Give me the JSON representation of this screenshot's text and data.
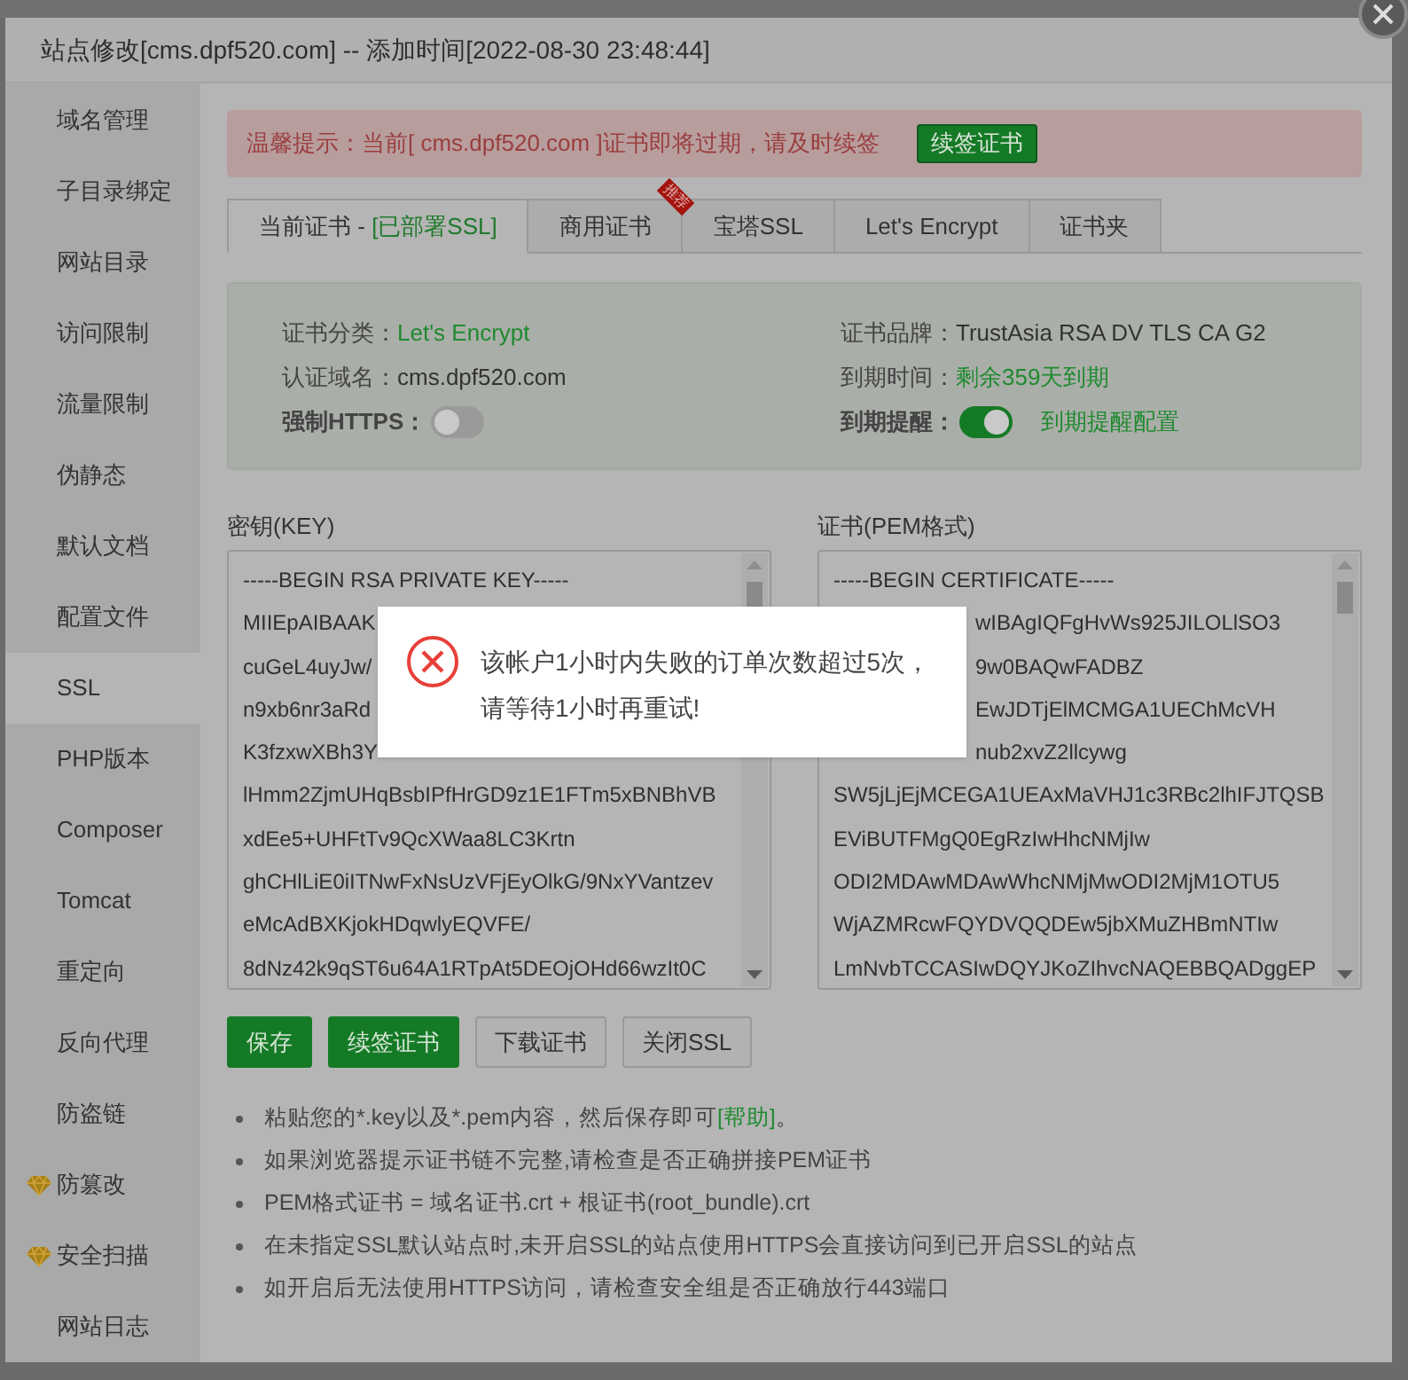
{
  "dialog": {
    "title": "站点修改[cms.dpf520.com] -- 添加时间[2022-08-30 23:48:44]"
  },
  "sidebar": {
    "items": [
      {
        "label": "域名管理",
        "selected": false,
        "premium": false
      },
      {
        "label": "子目录绑定",
        "selected": false,
        "premium": false
      },
      {
        "label": "网站目录",
        "selected": false,
        "premium": false
      },
      {
        "label": "访问限制",
        "selected": false,
        "premium": false
      },
      {
        "label": "流量限制",
        "selected": false,
        "premium": false
      },
      {
        "label": "伪静态",
        "selected": false,
        "premium": false
      },
      {
        "label": "默认文档",
        "selected": false,
        "premium": false
      },
      {
        "label": "配置文件",
        "selected": false,
        "premium": false
      },
      {
        "label": "SSL",
        "selected": true,
        "premium": false
      },
      {
        "label": "PHP版本",
        "selected": false,
        "premium": false
      },
      {
        "label": "Composer",
        "selected": false,
        "premium": false
      },
      {
        "label": "Tomcat",
        "selected": false,
        "premium": false
      },
      {
        "label": "重定向",
        "selected": false,
        "premium": false
      },
      {
        "label": "反向代理",
        "selected": false,
        "premium": false
      },
      {
        "label": "防盗链",
        "selected": false,
        "premium": false
      },
      {
        "label": "防篡改",
        "selected": false,
        "premium": true
      },
      {
        "label": "安全扫描",
        "selected": false,
        "premium": true
      },
      {
        "label": "网站日志",
        "selected": false,
        "premium": false
      }
    ]
  },
  "alert": {
    "text": "温馨提示：当前[ cms.dpf520.com ]证书即将过期，请及时续签",
    "button": "续签证书"
  },
  "tabs": [
    {
      "label": "当前证书 - ",
      "status": "[已部署SSL]",
      "selected": true
    },
    {
      "label": "商用证书",
      "ribbon": "推荐",
      "selected": false
    },
    {
      "label": "宝塔SSL",
      "selected": false
    },
    {
      "label": "Let's Encrypt",
      "selected": false
    },
    {
      "label": "证书夹",
      "selected": false
    }
  ],
  "cert_info": [
    {
      "label": "证书分类：",
      "value": "Let's Encrypt",
      "kind": "green"
    },
    {
      "label": "证书品牌：",
      "value": "TrustAsia RSA DV TLS CA G2",
      "kind": "plain"
    },
    {
      "label": "认证域名：",
      "value": "cms.dpf520.com",
      "kind": "plain"
    },
    {
      "label": "到期时间：",
      "value": "剩余359天到期",
      "kind": "green"
    },
    {
      "label": "强制HTTPS：",
      "on": false,
      "kind": "toggle"
    },
    {
      "label": "到期提醒：",
      "on": true,
      "link": "到期提醒配置",
      "kind": "toggle"
    }
  ],
  "key_box": {
    "label": "密钥(KEY)",
    "lines": [
      {
        "text": "-----BEGIN RSA PRIVATE KEY-----"
      },
      {
        "text": "MIIEpAIBAAK"
      },
      {
        "text": "cuGeL4uyJw/"
      },
      {
        "text": "n9xb6nr3aRd"
      },
      {
        "text": "K3fzxwXBh3Y"
      },
      {
        "text": "lHmm2ZjmUHqBsbIPfHrGD9z1E1FTm5xBNBhVB"
      },
      {
        "text": "xdEe5+UHFtTv9QcXWaa8LC3Krtn"
      },
      {
        "text": "ghCHlLiE0iITNwFxNsUzVFjEyOlkG/9NxYVantzev"
      },
      {
        "text": "eMcAdBXKjokHDqwlyEQVFE/"
      },
      {
        "text": "8dNz42k9qST6u64A1RTpAt5DEOjOHd66wzIt0C"
      }
    ]
  },
  "cert_box": {
    "label": "证书(PEM格式)",
    "lines": [
      {
        "text": "-----BEGIN CERTIFICATE-----",
        "partial": false
      },
      {
        "text": "wIBAgIQFgHvWs925JILOLlSO3",
        "partial": true
      },
      {
        "text": "9w0BAQwFADBZ",
        "partial": true
      },
      {
        "text": "EwJDTjElMCMGA1UEChMcVH",
        "partial": true
      },
      {
        "text": "nub2xvZ2llcywg",
        "partial": true
      },
      {
        "text": "SW5jLjEjMCEGA1UEAxMaVHJ1c3RBc2lhIFJTQSB",
        "partial": false
      },
      {
        "text": "EViBUTFMgQ0EgRzIwHhcNMjIw",
        "partial": false
      },
      {
        "text": "ODI2MDAwMDAwWhcNMjMwODI2MjM1OTU5",
        "partial": false
      },
      {
        "text": "WjAZMRcwFQYDVQQDEw5jbXMuZHBmNTIw",
        "partial": false
      },
      {
        "text": "LmNvbTCCASIwDQYJKoZIhvcNAQEBBQADggEP",
        "partial": false
      }
    ]
  },
  "buttons": [
    {
      "label": "保存",
      "kind": "primary"
    },
    {
      "label": "续签证书",
      "kind": "primary"
    },
    {
      "label": "下载证书",
      "kind": "secondary"
    },
    {
      "label": "关闭SSL",
      "kind": "secondary"
    }
  ],
  "notes": [
    {
      "text": "粘贴您的*.key以及*.pem内容，然后保存即可",
      "link": "[帮助]",
      "tail": "。"
    },
    {
      "text": "如果浏览器提示证书链不完整,请检查是否正确拼接PEM证书"
    },
    {
      "text": "PEM格式证书 = 域名证书.crt + 根证书(root_bundle).crt"
    },
    {
      "text": "在未指定SSL默认站点时,未开启SSL的站点使用HTTPS会直接访问到已开启SSL的站点"
    },
    {
      "text": "如开启后无法使用HTTPS访问，请检查安全组是否正确放行443端口"
    }
  ],
  "toast": {
    "kind": "error",
    "text": "该帐户1小时内失败的订单次数超过5次，请等待1小时再重试!"
  }
}
